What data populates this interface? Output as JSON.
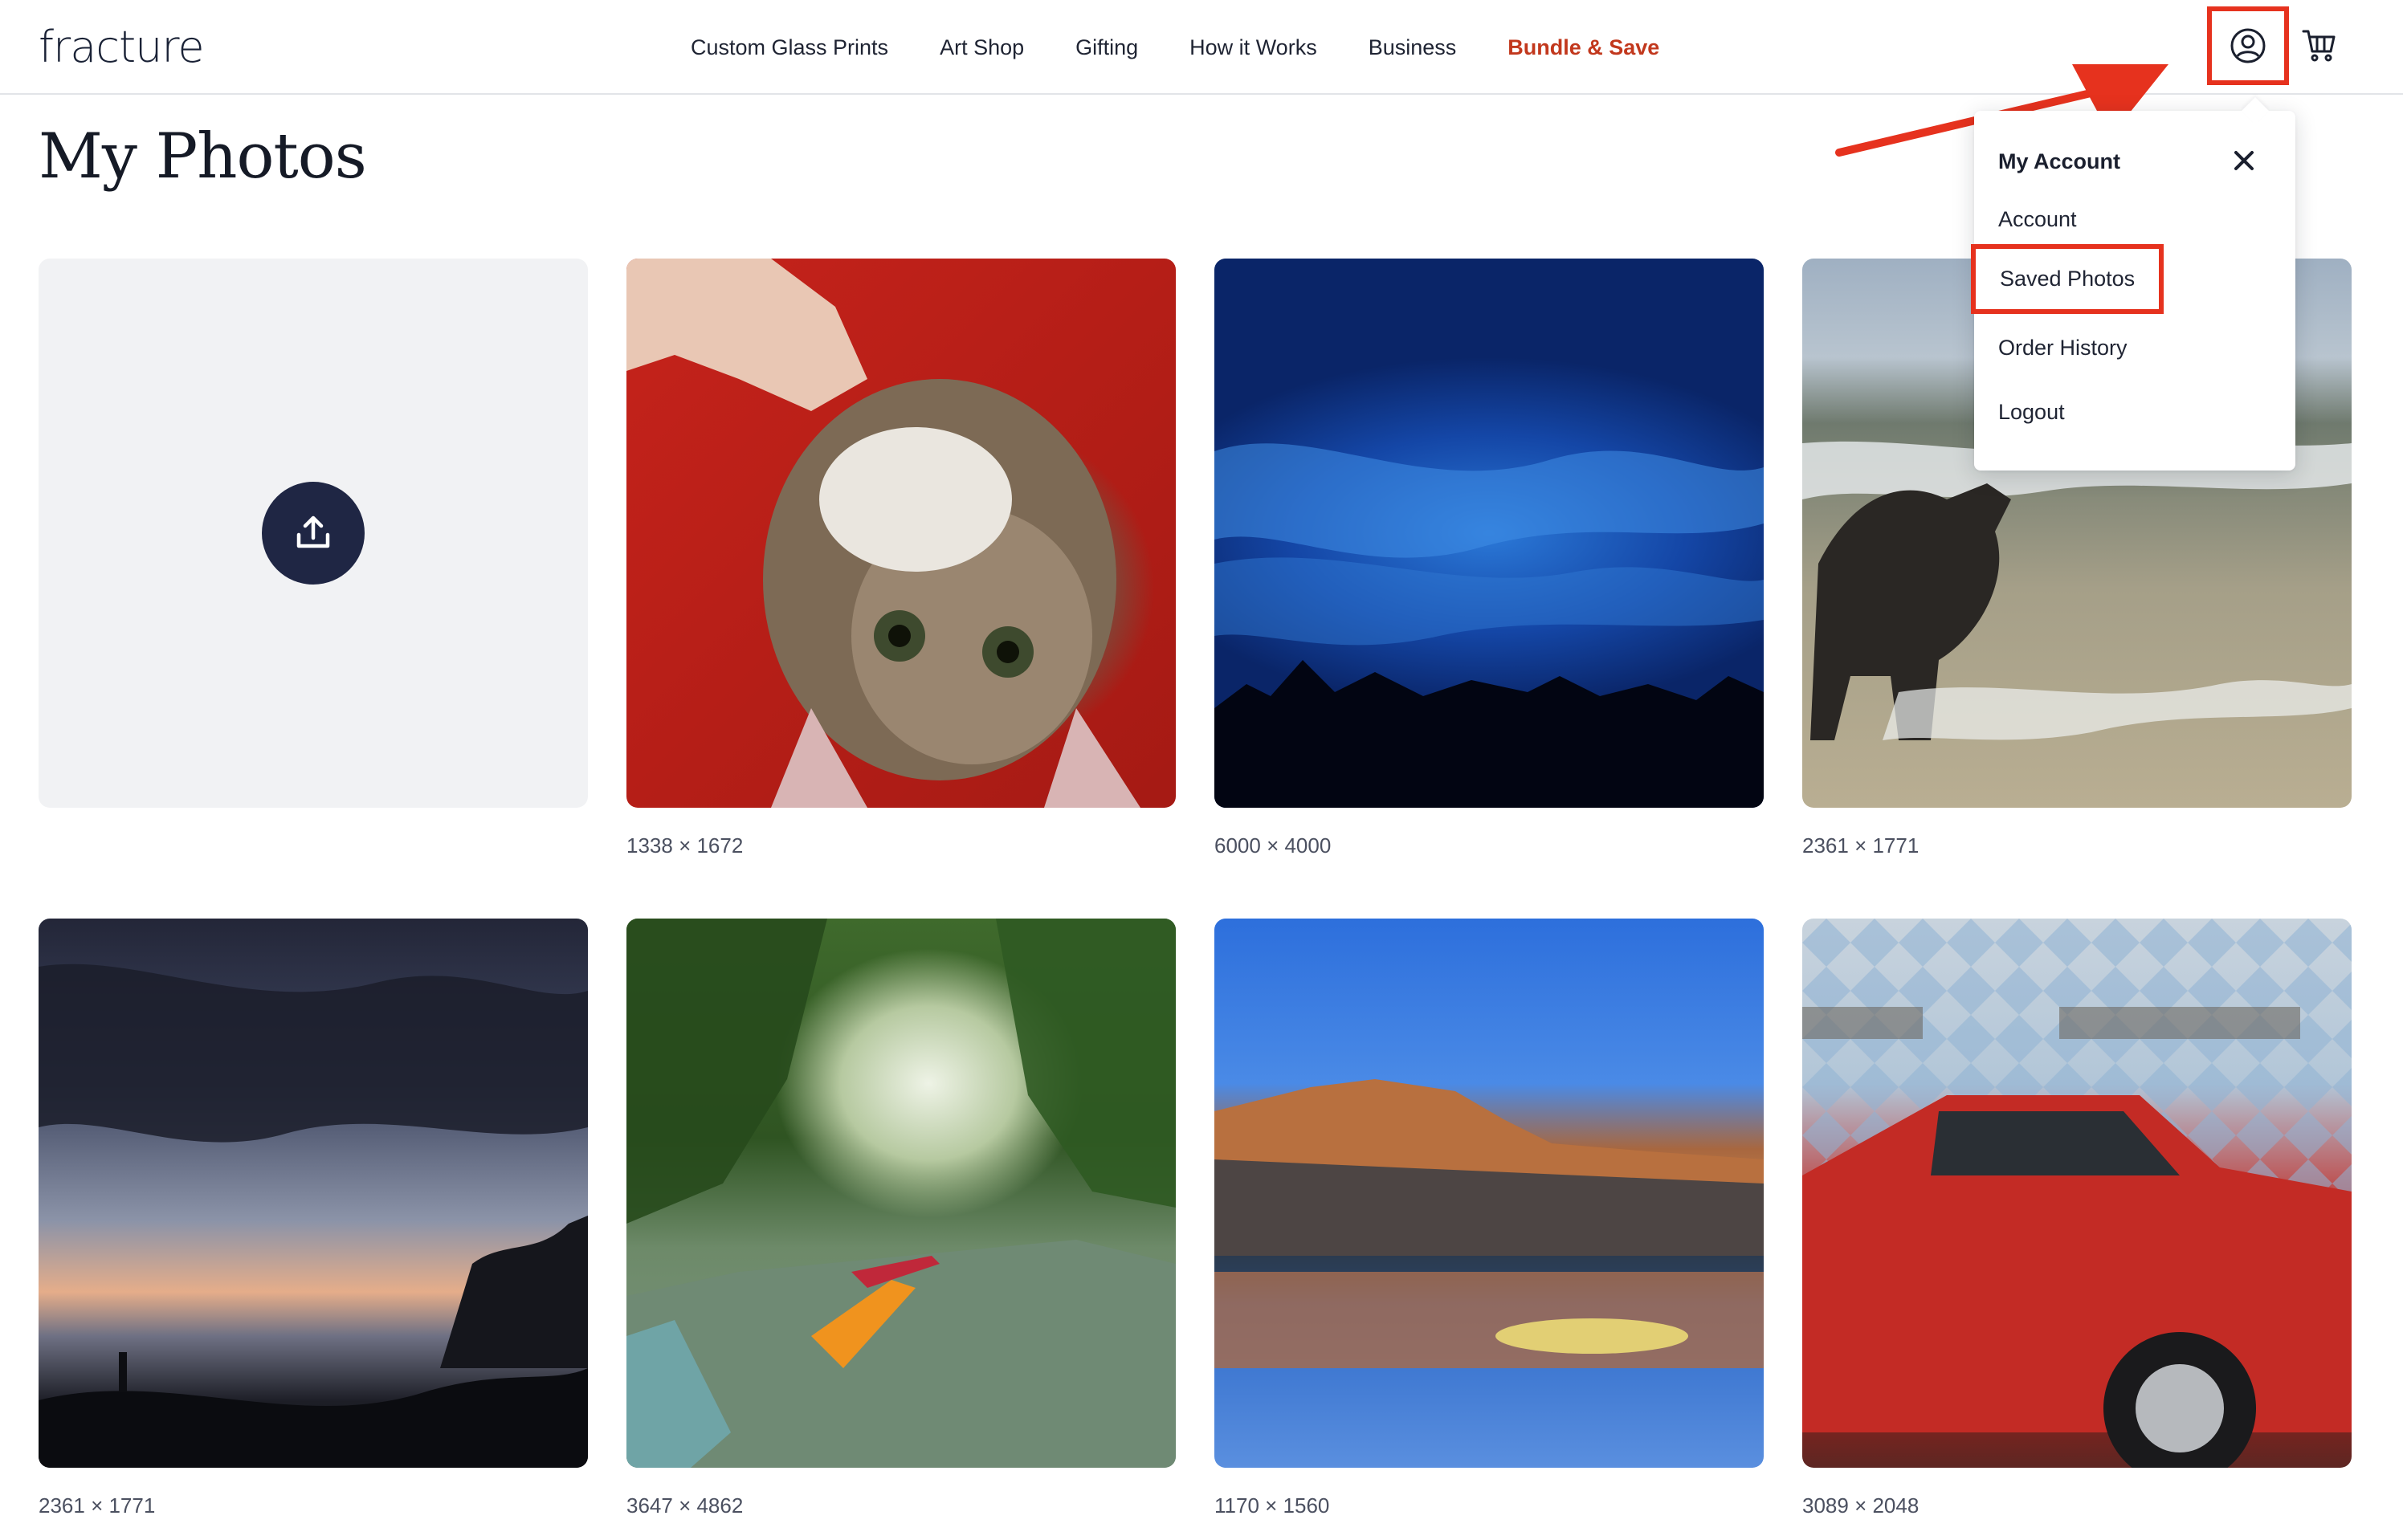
{
  "brand": {
    "logo_text": "fracture"
  },
  "nav": {
    "items": [
      {
        "label": "Custom Glass Prints"
      },
      {
        "label": "Art Shop"
      },
      {
        "label": "Gifting"
      },
      {
        "label": "How it Works"
      },
      {
        "label": "Business"
      },
      {
        "label": "Bundle & Save"
      }
    ]
  },
  "header_icons": {
    "account": "user-circle-icon",
    "cart": "cart-icon"
  },
  "page": {
    "title": "My Photos"
  },
  "upload": {
    "icon": "upload-icon"
  },
  "photos": [
    {
      "dims": "1338 × 1672"
    },
    {
      "dims": "6000 × 4000"
    },
    {
      "dims": "2361 × 1771"
    },
    {
      "dims": "2361 × 1771"
    },
    {
      "dims": "3647 × 4862"
    },
    {
      "dims": "1170 × 1560"
    },
    {
      "dims": "3089 × 2048"
    }
  ],
  "account_menu": {
    "title": "My Account",
    "items": [
      {
        "label": "Account"
      },
      {
        "label": "Saved Photos"
      },
      {
        "label": "Order History"
      },
      {
        "label": "Logout"
      }
    ]
  },
  "colors": {
    "accent_promo": "#c2381d",
    "annotation_red": "#e6321e",
    "upload_button": "#1f2644",
    "upload_tile_bg": "#f1f2f4"
  }
}
